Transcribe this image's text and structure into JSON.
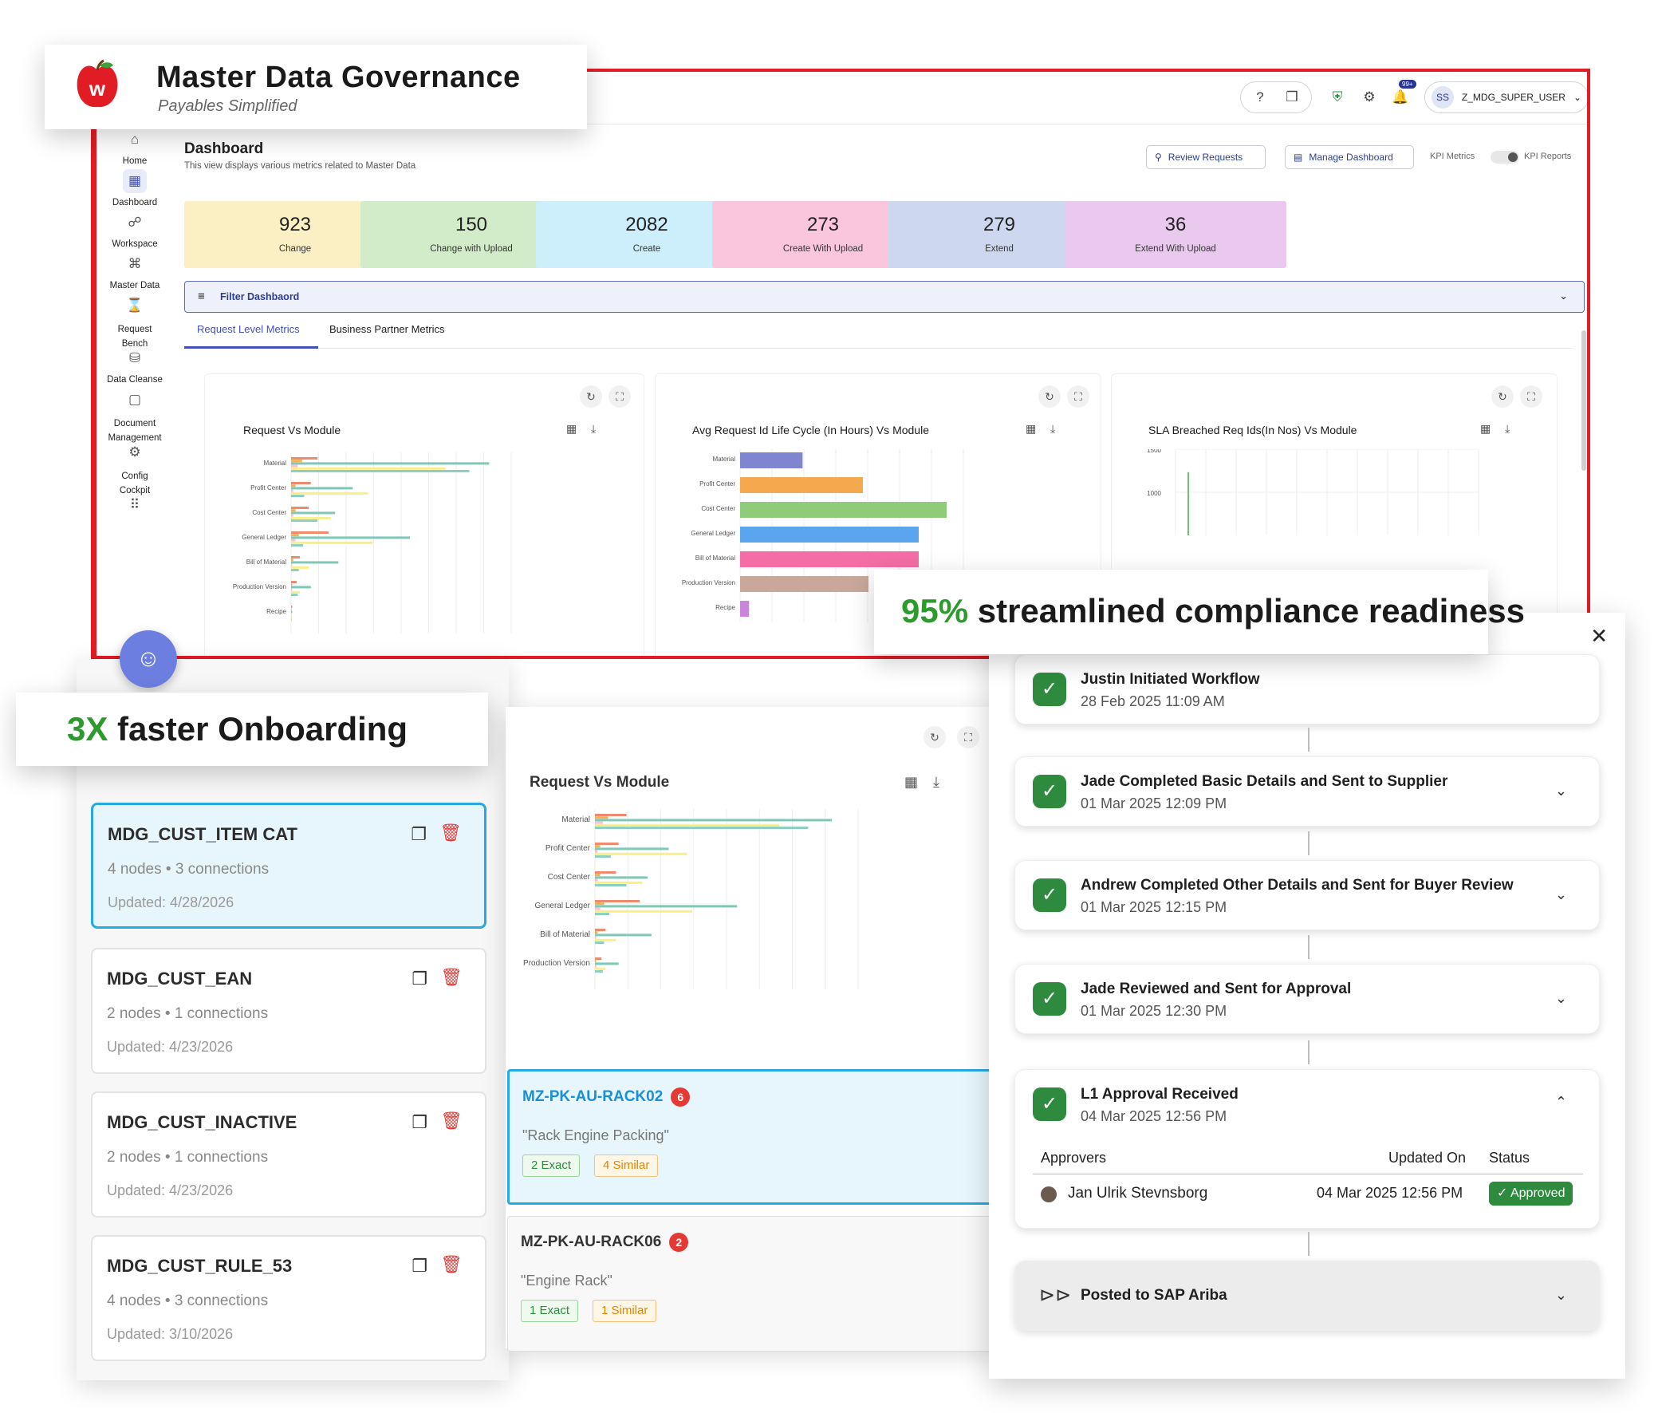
{
  "brand": {
    "title": "Master Data Governance",
    "subtitle": "Payables Simplified",
    "logo_letter": "w"
  },
  "topbar": {
    "notif_badge": "99+",
    "user_initials": "SS",
    "user_name": "Z_MDG_SUPER_USER"
  },
  "sidebar": {
    "items": [
      {
        "label": "Home",
        "icon": "home-icon"
      },
      {
        "label": "Dashboard",
        "icon": "dashboard-icon"
      },
      {
        "label": "Workspace",
        "icon": "workspace-icon"
      },
      {
        "label": "Master Data",
        "icon": "master-data-icon"
      },
      {
        "label": "Request\nBench",
        "icon": "request-bench-icon"
      },
      {
        "label": "Data Cleanse",
        "icon": "data-cleanse-icon"
      },
      {
        "label": "Document\nManagement",
        "icon": "document-icon"
      },
      {
        "label": "Config\nCockpit",
        "icon": "config-icon"
      }
    ]
  },
  "page": {
    "title": "Dashboard",
    "subtitle": "This view displays various metrics related to Master Data"
  },
  "actions": {
    "review": "Review Requests",
    "manage": "Manage Dashboard",
    "toggle_left": "KPI Metrics",
    "toggle_right": "KPI Reports"
  },
  "kpis": [
    {
      "value": "923",
      "label": "Change",
      "color": "#fbf0c4"
    },
    {
      "value": "150",
      "label": "Change with Upload",
      "color": "#d2ecc9"
    },
    {
      "value": "2082",
      "label": "Create",
      "color": "#cdeefb"
    },
    {
      "value": "273",
      "label": "Create With Upload",
      "color": "#f9c6de"
    },
    {
      "value": "279",
      "label": "Extend",
      "color": "#cdd8ef"
    },
    {
      "value": "36",
      "label": "Extend With Upload",
      "color": "#e9c9ee"
    }
  ],
  "filter": {
    "label": "Filter Dashbaord"
  },
  "tabs": [
    "Request Level Metrics",
    "Business Partner Metrics"
  ],
  "chart_data": [
    {
      "type": "bar",
      "title": "Request Vs Module",
      "categories": [
        "Material",
        "Profit Center",
        "Cost Center",
        "General Ledger",
        "Bill of Material",
        "Production Version",
        "Recipe"
      ],
      "series": [
        {
          "values": [
            120,
            90,
            80,
            170,
            40,
            25,
            5
          ]
        },
        {
          "values": [
            50,
            20,
            20,
            35,
            10,
            5,
            2
          ]
        },
        {
          "values": [
            900,
            280,
            200,
            540,
            215,
            90,
            5
          ]
        },
        {
          "values": [
            30,
            10,
            10,
            20,
            5,
            5,
            2
          ]
        },
        {
          "values": [
            700,
            350,
            180,
            370,
            80,
            40,
            5
          ]
        },
        {
          "values": [
            810,
            60,
            120,
            55,
            35,
            30,
            2
          ]
        }
      ]
    },
    {
      "type": "bar",
      "title": "Avg Request Id Life Cycle (In Hours) Vs Module",
      "categories": [
        "Material",
        "Profit Center",
        "Cost Center",
        "General Ledger",
        "Bill of Material",
        "Production Version",
        "Recipe"
      ],
      "values": [
        56,
        110,
        185,
        160,
        160,
        115,
        8
      ],
      "colors": [
        "#7f85cf",
        "#f5a94f",
        "#8fcc7a",
        "#5aa5ee",
        "#f46da7",
        "#c9a79b",
        "#c986d8"
      ]
    },
    {
      "type": "bar",
      "title": "SLA Breached Req Ids(In Nos) Vs Module",
      "yticks": [
        "1500",
        "1000"
      ],
      "values": [
        1100
      ],
      "ylim": [
        0,
        1500
      ]
    },
    {
      "type": "bar",
      "title": "Request Vs Module",
      "categories": [
        "Material",
        "Profit Center",
        "Cost Center",
        "General Ledger",
        "Bill of Material",
        "Production Version"
      ],
      "series": [
        {
          "values": [
            120,
            90,
            80,
            170,
            40,
            25
          ]
        },
        {
          "values": [
            50,
            20,
            20,
            35,
            10,
            5
          ]
        },
        {
          "values": [
            900,
            280,
            200,
            540,
            215,
            90
          ]
        },
        {
          "values": [
            30,
            10,
            10,
            20,
            5,
            5
          ]
        },
        {
          "values": [
            700,
            350,
            180,
            370,
            80,
            40
          ]
        },
        {
          "values": [
            810,
            60,
            120,
            55,
            35,
            30
          ]
        }
      ]
    }
  ],
  "callouts": {
    "compliance_pct": "95%",
    "compliance_text": "streamlined compliance readiness",
    "onboarding_pct": "3X",
    "onboarding_text": "faster Onboarding"
  },
  "rules": [
    {
      "name": "MDG_CUST_ITEM CAT",
      "meta": "4 nodes • 3 connections",
      "updated": "Updated: 4/28/2026",
      "selected": true
    },
    {
      "name": "MDG_CUST_EAN",
      "meta": "2 nodes • 1 connections",
      "updated": "Updated: 4/23/2026"
    },
    {
      "name": "MDG_CUST_INACTIVE",
      "meta": "2 nodes • 1 connections",
      "updated": "Updated: 4/23/2026"
    },
    {
      "name": "MDG_CUST_RULE_53",
      "meta": "4 nodes • 3 connections",
      "updated": "Updated: 3/10/2026"
    }
  ],
  "matches": [
    {
      "code": "MZ-PK-AU-RACK02",
      "count": "6",
      "desc": "\"Rack Engine Packing\"",
      "exact": "2 Exact",
      "similar": "4 Similar"
    },
    {
      "code": "MZ-PK-AU-RACK06",
      "count": "2",
      "desc": "\"Engine Rack\"",
      "exact": "1 Exact",
      "similar": "1 Similar"
    }
  ],
  "workflow": [
    {
      "title": "Justin Initiated Workflow",
      "date": "28 Feb 2025 11:09 AM"
    },
    {
      "title": "Jade Completed Basic Details and Sent to Supplier",
      "date": "01 Mar 2025 12:09 PM"
    },
    {
      "title": "Andrew Completed Other Details and Sent for Buyer Review",
      "date": "01 Mar 2025 12:15 PM"
    },
    {
      "title": "Jade Reviewed and Sent for Approval",
      "date": "01 Mar 2025 12:30 PM"
    },
    {
      "title": "L1 Approval Received",
      "date": "04 Mar 2025 12:56 PM"
    }
  ],
  "approvals": {
    "col_approvers": "Approvers",
    "col_updated": "Updated On",
    "col_status": "Status",
    "row": {
      "name": "Jan Ulrik Stevnsborg",
      "date": "04 Mar 2025 12:56 PM",
      "status": "Approved"
    }
  },
  "posted": {
    "label": "Posted to SAP Ariba"
  }
}
